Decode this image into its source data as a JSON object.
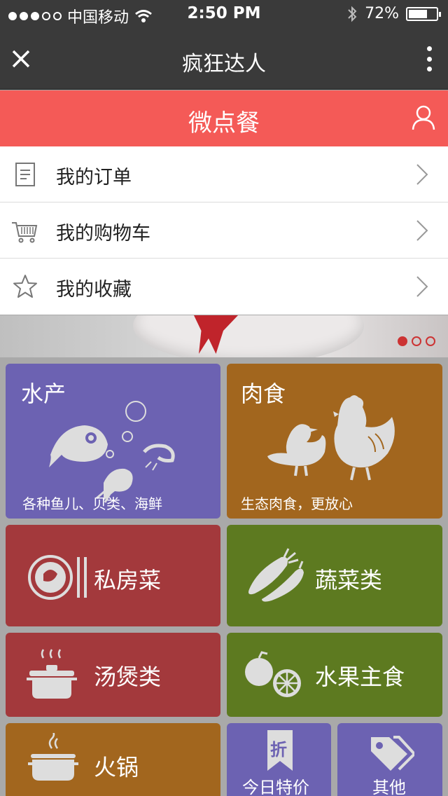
{
  "status": {
    "carrier": "中国移动",
    "time": "2:50 PM",
    "battery": "72%",
    "battery_level": 0.72
  },
  "nav": {
    "title": "疯狂达人"
  },
  "header": {
    "title": "微点餐"
  },
  "menu": [
    {
      "label": "我的订单",
      "icon": "order-list-icon"
    },
    {
      "label": "我的购物车",
      "icon": "cart-icon"
    },
    {
      "label": "我的收藏",
      "icon": "star-icon"
    }
  ],
  "colors": {
    "accent_red": "#f45a57",
    "purple": "#6c62b2",
    "orange": "#a2661e",
    "red": "#a3393c",
    "green": "#5d7a20"
  },
  "categories": {
    "seafood": {
      "title": "水产",
      "subtitle": "各种鱼儿、贝类、海鲜"
    },
    "meat": {
      "title": "肉食",
      "subtitle": "生态肉食，更放心"
    },
    "private": {
      "title": "私房菜"
    },
    "vegetables": {
      "title": "蔬菜类"
    },
    "soup": {
      "title": "汤煲类"
    },
    "fruit": {
      "title": "水果主食"
    },
    "hotpot": {
      "title": "火锅"
    },
    "special": {
      "title": "今日特价",
      "badge": "折"
    },
    "other": {
      "title": "其他"
    }
  }
}
